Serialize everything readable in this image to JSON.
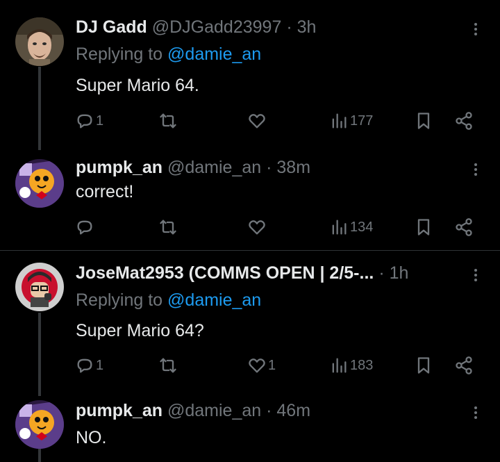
{
  "tweets": [
    {
      "name": "DJ Gadd",
      "handle": "@DJGadd23997",
      "sep": "·",
      "time": "3h",
      "replying_prefix": "Replying to ",
      "replying_to": "@damie_an",
      "text": "Super Mario 64.",
      "replies": "1",
      "retweets": "",
      "likes": "",
      "views": "177"
    },
    {
      "name": "pumpk_an",
      "handle": "@damie_an",
      "sep": "·",
      "time": "38m",
      "text": "correct!",
      "replies": "",
      "retweets": "",
      "likes": "",
      "views": "134"
    },
    {
      "name": "JoseMat2953 (COMMS OPEN | 2/5-...",
      "handle": "",
      "sep": "·",
      "time": "1h",
      "replying_prefix": "Replying to ",
      "replying_to": "@damie_an",
      "text": "Super Mario 64?",
      "replies": "1",
      "retweets": "",
      "likes": "1",
      "views": "183"
    },
    {
      "name": "pumpk_an",
      "handle": "@damie_an",
      "sep": "·",
      "time": "46m",
      "text": "NO."
    }
  ],
  "colors": {
    "background": "#000000",
    "text": "#e7e9ea",
    "muted": "#71767b",
    "link": "#1d9bf0"
  },
  "icons": [
    "reply-icon",
    "retweet-icon",
    "like-icon",
    "views-icon",
    "bookmark-icon",
    "share-icon",
    "more-icon"
  ]
}
